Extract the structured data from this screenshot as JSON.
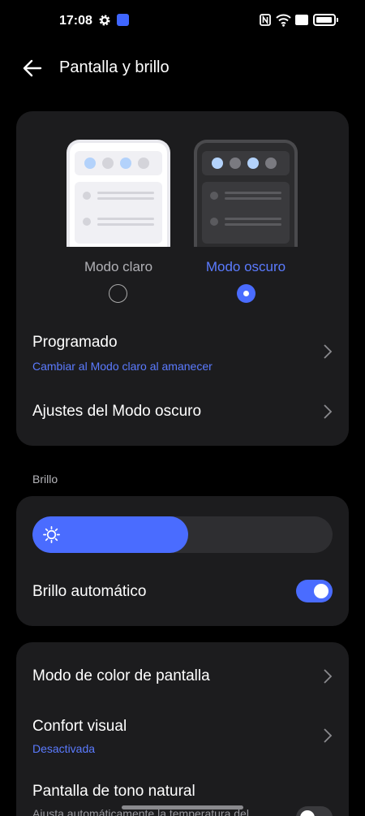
{
  "status_bar": {
    "time": "17:08",
    "icons": [
      "gear-icon",
      "app-notification-icon",
      "nfc-icon",
      "wifi-icon",
      "sim-off-icon",
      "battery-icon"
    ]
  },
  "header": {
    "title": "Pantalla y brillo",
    "back_icon": "back-arrow-icon"
  },
  "theme": {
    "light_label": "Modo claro",
    "dark_label": "Modo oscuro",
    "selected": "dark",
    "accent_color": "#4a6cff"
  },
  "theme_rows": [
    {
      "title": "Programado",
      "subtitle": "Cambiar al Modo claro al amanecer"
    },
    {
      "title": "Ajustes del Modo oscuro"
    }
  ],
  "brightness": {
    "section_label": "Brillo",
    "level_fraction": 0.52,
    "auto_label": "Brillo automático",
    "auto_enabled": true
  },
  "display_rows": [
    {
      "title": "Modo de color de pantalla"
    },
    {
      "title": "Confort visual",
      "subtitle": "Desactivada"
    },
    {
      "title": "Pantalla de tono natural",
      "description": "Ajusta automáticamente la temperatura del",
      "enabled": false
    }
  ]
}
